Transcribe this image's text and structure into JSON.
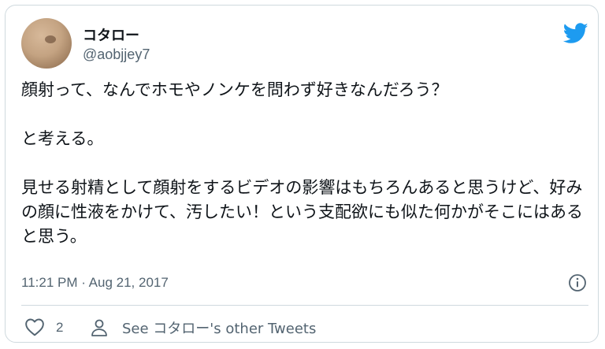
{
  "author": {
    "display_name": "コタロー",
    "handle": "@aobjjey7"
  },
  "tweet": {
    "paragraphs": [
      "顔射って、なんでホモやノンケを問わず好きなんだろう？",
      "と考える。",
      "見せる射精として顔射をするビデオの影響はもちろんあると思うけど、好みの顔に性液をかけて、汚したい！という支配欲にも似た何かがそこにはあると思う。"
    ],
    "timestamp": "11:21 PM · Aug 21, 2017"
  },
  "actions": {
    "like_count": "2",
    "other_tweets_label": "See コタロー's other Tweets"
  },
  "icons": {
    "brand": "twitter-bird-icon",
    "info": "info-icon",
    "like": "heart-icon",
    "profile": "person-icon"
  },
  "colors": {
    "twitter_blue": "#1d9bf0",
    "text_primary": "#0f1419",
    "text_secondary": "#536471",
    "border": "#cfd9de"
  }
}
